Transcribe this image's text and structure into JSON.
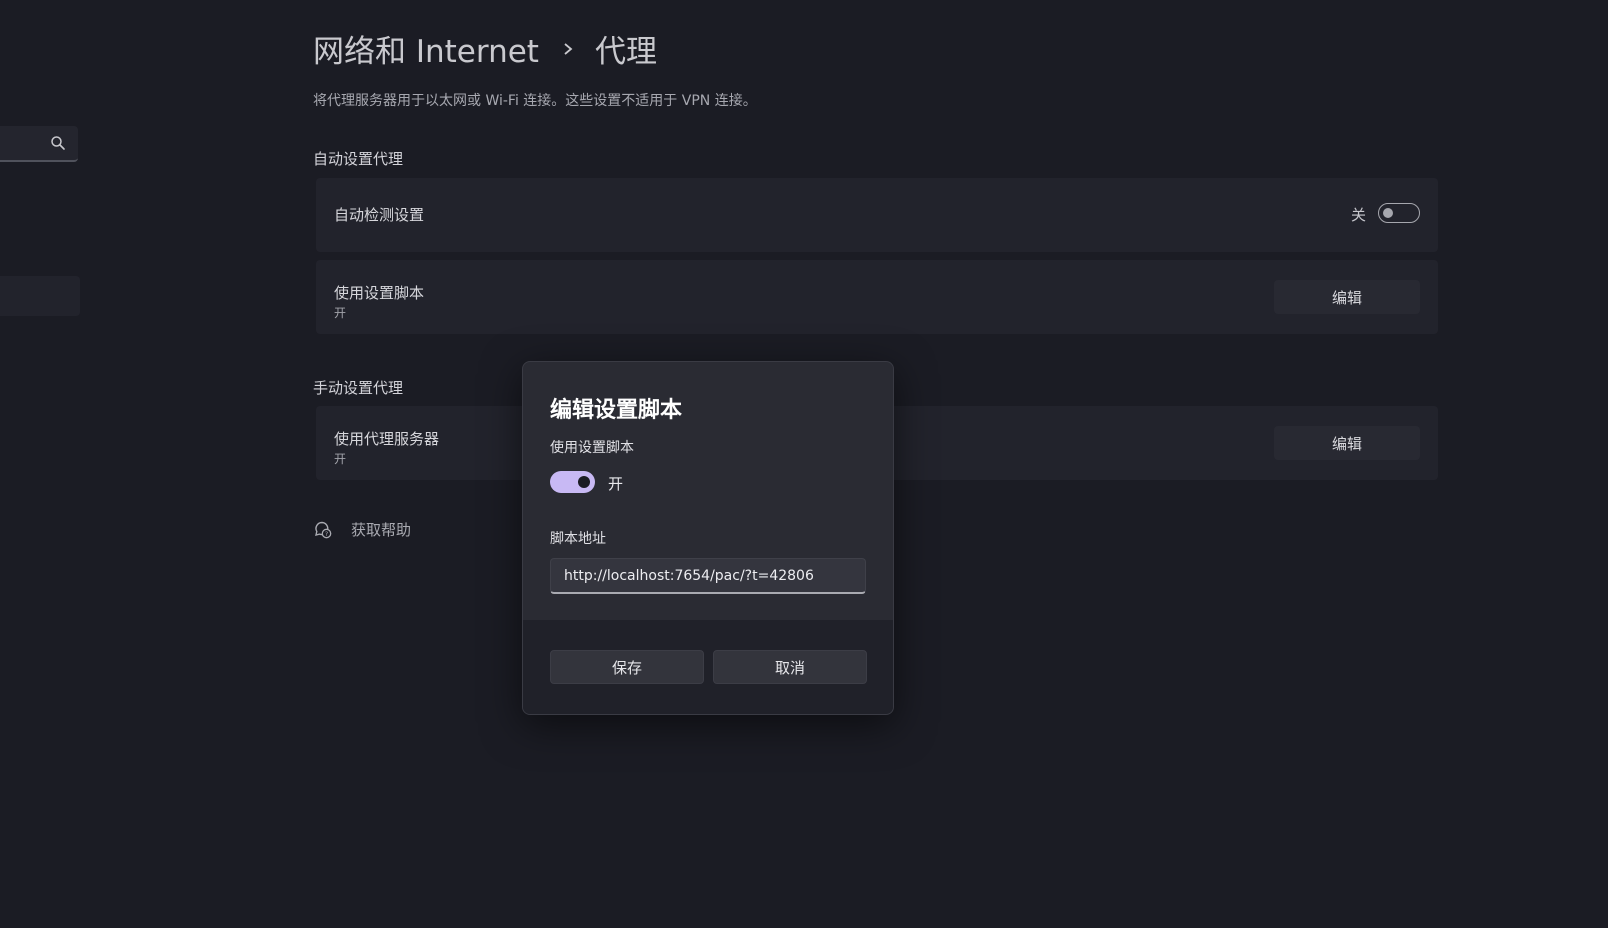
{
  "header": {
    "breadcrumb_parent": "网络和 Internet",
    "breadcrumb_current": "代理",
    "subtitle": "将代理服务器用于以太网或 Wi-Fi 连接。这些设置不适用于 VPN 连接。"
  },
  "auto_proxy": {
    "heading": "自动设置代理",
    "detect": {
      "label": "自动检测设置",
      "state_label": "关",
      "on": false
    },
    "script": {
      "label": "使用设置脚本",
      "status": "开",
      "edit_label": "编辑"
    }
  },
  "manual_proxy": {
    "heading": "手动设置代理",
    "server": {
      "label": "使用代理服务器",
      "status": "开",
      "edit_label": "编辑"
    }
  },
  "help": {
    "label": "获取帮助"
  },
  "dialog": {
    "title": "编辑设置脚本",
    "toggle_label": "使用设置脚本",
    "toggle_state": "开",
    "toggle_on": true,
    "address_label": "脚本地址",
    "address_value": "http://localhost:7654/pac/?t=42806",
    "save_label": "保存",
    "cancel_label": "取消"
  },
  "colors": {
    "background": "#1b1c24",
    "card": "#22232c",
    "accent": "#c8b9f4"
  }
}
